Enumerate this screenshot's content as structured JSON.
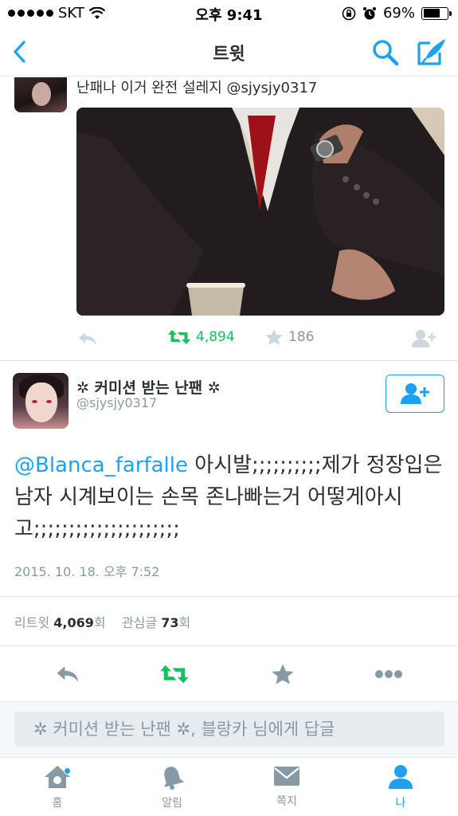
{
  "status_bar": {
    "carrier": "SKT",
    "time": "오후 9:41",
    "battery": "69%",
    "battery_level": 0.69
  },
  "nav": {
    "title": "트윗",
    "icons": [
      "back-icon",
      "search-icon",
      "compose-icon"
    ]
  },
  "previous_tweet": {
    "text": "난패나 이거 완전 설레지 @sjysjy0317",
    "retweets": "4,894",
    "likes": "186"
  },
  "tweet": {
    "display_name": "✲ 커미션 받는 난팬 ✲",
    "handle": "@sjysjy0317",
    "mention": "@Blanca_farfalle",
    "text": " 아시발;;;;;;;;;;제가 정장입은 남자 시계보이는 손목 존나빠는거 어떻게아시고;;;;;;;;;;;;;;;;;;;;;",
    "timestamp": "2015. 10. 18. 오후 7:52",
    "retweet_label": "리트윗",
    "retweet_count": "4,069",
    "retweet_unit": "회",
    "like_label": "관심글",
    "like_count": "73",
    "like_unit": "회"
  },
  "reply": {
    "placeholder": "✲ 커미션 받는 난팬 ✲, 블랑카 님에게 답글"
  },
  "tabs": [
    {
      "label": "홈",
      "icon": "home-icon",
      "active": false
    },
    {
      "label": "알림",
      "icon": "bell-icon",
      "active": false
    },
    {
      "label": "쪽지",
      "icon": "envelope-icon",
      "active": false
    },
    {
      "label": "나",
      "icon": "person-icon",
      "active": true
    }
  ],
  "colors": {
    "accent": "#1da1f2",
    "retweet_green": "#17bf63",
    "muted": "#8899a6"
  }
}
